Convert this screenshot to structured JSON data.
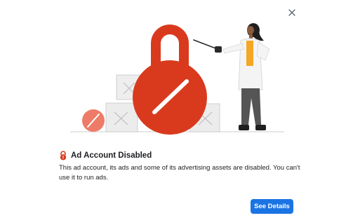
{
  "dialog": {
    "title": "Ad Account Disabled",
    "message": "This ad account, its ads and some of its advertising assets are disabled. You can't use it to run ads.",
    "primary_button_label": "See Details",
    "close_icon": "close-icon",
    "title_icon": "lock-warning-icon"
  },
  "colors": {
    "accent": "#1b74e4",
    "lock_red": "#d93a1e",
    "coral": "#ee7b68",
    "text": "#1c1e21"
  }
}
